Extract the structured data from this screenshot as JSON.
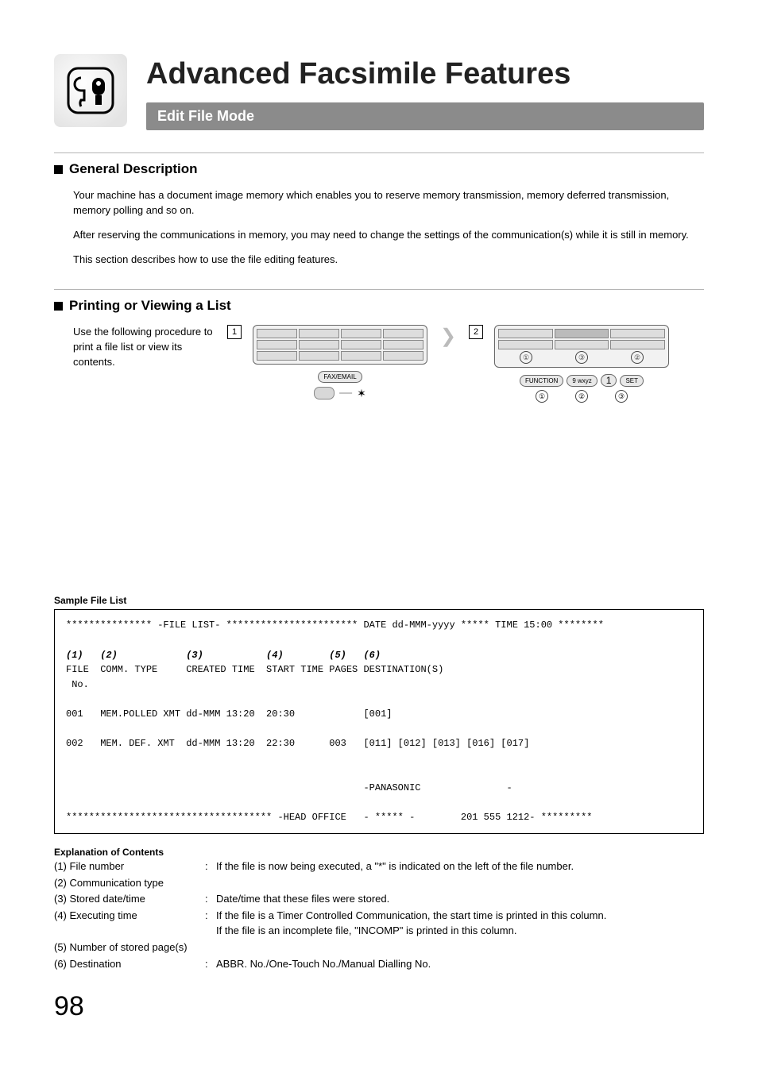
{
  "header": {
    "chapter_title": "Advanced Facsimile Features",
    "subheader": "Edit File Mode"
  },
  "sections": {
    "general": {
      "title": "General Description",
      "p1": "Your machine has a document image memory which enables you to reserve memory transmission, memory deferred transmission, memory polling and so on.",
      "p2": "After reserving the communications in memory, you may need to change the settings of the communication(s) while it is still in memory.",
      "p3": "This section describes how to use the file editing features."
    },
    "printing": {
      "title": "Printing or Viewing a List",
      "proc_text": "Use the following procedure to print a file list or view its contents.",
      "step1": "1",
      "step2": "2",
      "panel1_tag": "FAX/EMAIL",
      "panel2_tags": {
        "left": "FUNCTION",
        "key": "9 wxyz",
        "one": "1",
        "right": "SET"
      },
      "circled": {
        "c1": "①",
        "c2": "②",
        "c3": "③"
      }
    }
  },
  "sample": {
    "heading": "Sample File List",
    "line1": "*************** -FILE LIST- *********************** DATE dd-MMM-yyyy ***** TIME 15:00 ********",
    "idx": "(1)   (2)            (3)           (4)        (5)   (6)",
    "hdr": "FILE  COMM. TYPE     CREATED TIME  START TIME PAGES DESTINATION(S)\n No.",
    "row1": "001   MEM.POLLED XMT dd-MMM 13:20  20:30            [001]",
    "row2": "002   MEM. DEF. XMT  dd-MMM 13:20  22:30      003   [011] [012] [013] [016] [017]",
    "row3": "                                                    -PANASONIC               -",
    "foot": "************************************ -HEAD OFFICE   - ***** -        201 555 1212- *********"
  },
  "explain": {
    "heading": "Explanation of Contents",
    "items": [
      {
        "label": "(1) File number",
        "desc": "If the file is now being executed, a \"*\" is indicated on the left of the file number."
      },
      {
        "label": "(2) Communication type",
        "desc": ""
      },
      {
        "label": "(3) Stored date/time",
        "desc": "Date/time that these files were stored."
      },
      {
        "label": "(4) Executing time",
        "desc": "If the file is a Timer Controlled Communication, the start time is printed in this column.\nIf the file is an incomplete file, \"INCOMP\" is printed in this column."
      },
      {
        "label": "(5) Number of stored page(s)",
        "desc": ""
      },
      {
        "label": "(6) Destination",
        "desc": "ABBR. No./One-Touch No./Manual Dialling No."
      }
    ]
  },
  "page_number": "98"
}
